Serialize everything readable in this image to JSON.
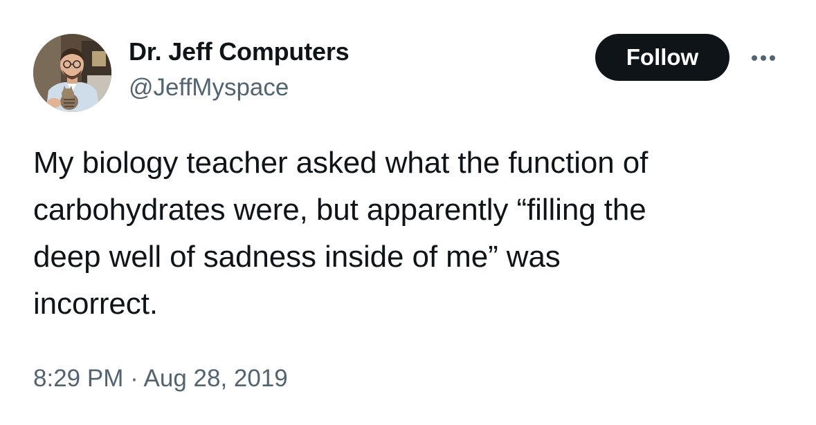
{
  "author": {
    "display_name": "Dr. Jeff Computers",
    "handle": "@JeffMyspace"
  },
  "actions": {
    "follow_label": "Follow",
    "more_icon": "more-horizontal-icon"
  },
  "tweet": {
    "text_lines": [
      "My biology teacher asked what the function of",
      "carbohydrates were, but apparently “filling the",
      "deep well of sadness inside of me” was",
      "incorrect."
    ],
    "timestamp": "8:29 PM · Aug 28, 2019"
  },
  "colors": {
    "text_primary": "#0f1419",
    "text_secondary": "#536471",
    "button_bg": "#0f1419",
    "button_text": "#ffffff"
  }
}
